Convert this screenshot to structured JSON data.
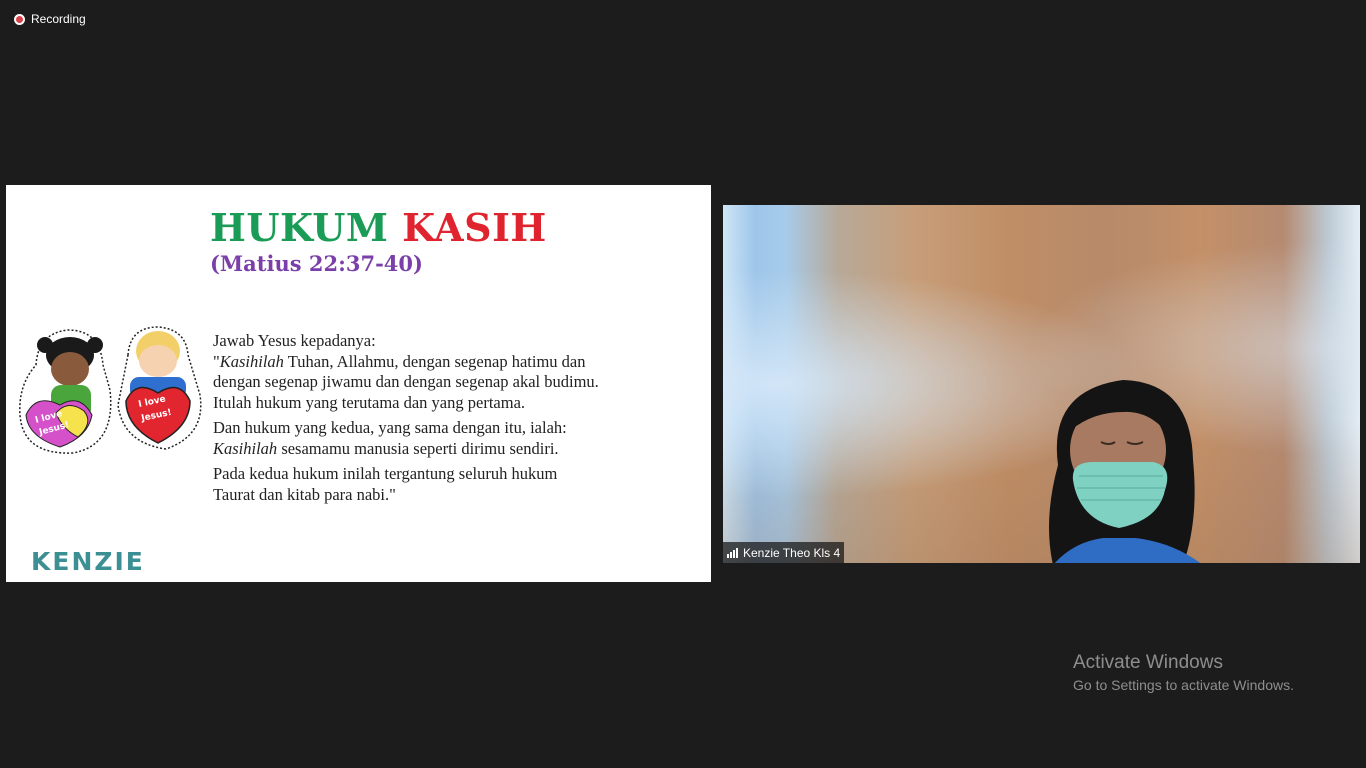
{
  "recording": {
    "label": "Recording",
    "icon": "record-icon",
    "color": "#d9414b"
  },
  "slide": {
    "title_part1": "HUKUM",
    "title_part2": "KASIH",
    "reference": "(Matius 22:37-40)",
    "paragraphs": {
      "p1_line1": "Jawab Yesus kepadanya:",
      "p1_line2_open": "\"",
      "p1_line2_em": "Kasihilah",
      "p1_line2_rest": " Tuhan, Allahmu, dengan segenap hatimu dan dengan segenap jiwamu dan dengan segenap akal budimu. Itulah hukum yang terutama dan yang pertama.",
      "p2_start": "Dan hukum yang kedua, yang sama dengan itu, ialah: ",
      "p2_em": "Kasihilah",
      "p2_rest": " sesamamu manusia seperti dirimu sendiri.",
      "p3": "Pada kedua hukum inilah tergantung seluruh hukum Taurat dan kitab para nabi.\""
    },
    "brand": "KENZIE",
    "stickers": {
      "left_text": "I love Jesus!",
      "right_text": "I love Jesus!"
    },
    "colors": {
      "title_green": "#1a9c56",
      "title_red": "#e0242f",
      "reference_purple": "#7a3fa8",
      "brand_teal": "#3c8f93"
    }
  },
  "video": {
    "participant_name": "Kenzie Theo Kls 4",
    "signal_icon": "signal-bars-icon"
  },
  "watermark": {
    "title": "Activate Windows",
    "subtitle": "Go to Settings to activate Windows."
  }
}
